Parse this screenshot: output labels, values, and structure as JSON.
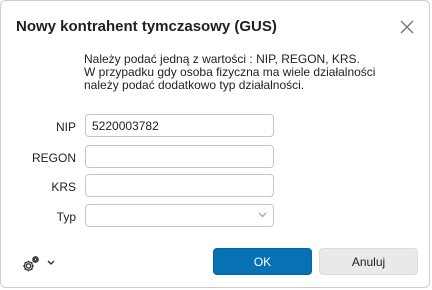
{
  "dialog": {
    "title": "Nowy kontrahent tymczasowy (GUS)",
    "close_icon": "close-icon"
  },
  "info": {
    "line1": "Należy podać jedną z wartości : NIP, REGON, KRS.",
    "line2": "W przypadku gdy osoba fizyczna ma wiele działalności",
    "line3": "należy podać dodatkowo typ działalności."
  },
  "form": {
    "nip_label": "NIP",
    "nip_value": "5220003782",
    "regon_label": "REGON",
    "regon_value": "",
    "krs_label": "KRS",
    "krs_value": "",
    "typ_label": "Typ",
    "typ_value": ""
  },
  "footer": {
    "settings_icon": "gear-icon",
    "dropdown_icon": "chevron-down-icon",
    "ok_label": "OK",
    "cancel_label": "Anuluj"
  },
  "colors": {
    "primary": "#0672b4",
    "secondary_button": "#e9e9e9",
    "border": "#c6c6c6"
  }
}
